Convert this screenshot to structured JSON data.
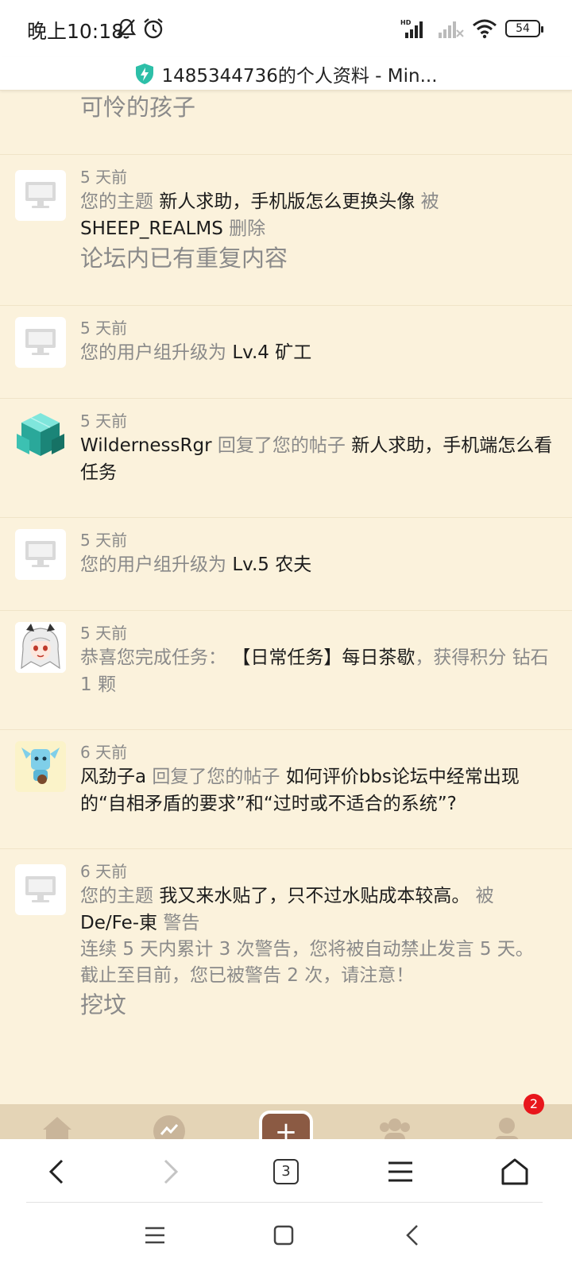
{
  "status_bar": {
    "time": "晚上10:18",
    "battery": "54",
    "icons": [
      "mute-bell-icon",
      "alarm-icon",
      "hd-signal-icon",
      "signal-no-service-icon",
      "wifi-icon",
      "battery-icon"
    ]
  },
  "url_bar": {
    "title": "1485344736的个人资料 - Min...",
    "icon": "shield-lightning-icon",
    "shield_color": "#2dbfa8"
  },
  "top_fragment": "可怜的孩子",
  "notifications": [
    {
      "avatar": "default-computer-icon",
      "time": "5 天前",
      "p1": "您的主题",
      "subject": "新人求助，手机版怎么更换头像",
      "p2": "被",
      "actor": "SHEEP_REALMS",
      "action": "删除",
      "reason": "论坛内已有重复内容"
    },
    {
      "avatar": "default-computer-icon",
      "time": "5 天前",
      "p1": "您的用户组升级为",
      "level": "Lv.4 矿工"
    },
    {
      "avatar": "diamond-block-avatar",
      "time": "5 天前",
      "user": "WildernessRgr",
      "p1": "回复了您的帖子",
      "subject": "新人求助，手机端怎么看任务"
    },
    {
      "avatar": "default-computer-icon",
      "time": "5 天前",
      "p1": "您的用户组升级为",
      "level": "Lv.5 农夫"
    },
    {
      "avatar": "anime-girl-avatar",
      "time": "5 天前",
      "p1": "恭喜您完成任务：",
      "task": "【日常任务】每日茶歇",
      "p2": "，获得积分 钻石 1 颗"
    },
    {
      "avatar": "blue-creature-avatar",
      "time": "6 天前",
      "user": "风劲子a",
      "p1": "回复了您的帖子",
      "subject": "如何评价bbs论坛中经常出现的“自相矛盾的要求”和“过时或不适合的系统”?"
    },
    {
      "avatar": "default-computer-icon",
      "time": "6 天前",
      "p1": "您的主题",
      "subject": "我又来水贴了，只不过水贴成本较高。",
      "p2": "被",
      "actor": "De/Fe-東",
      "action": "警告",
      "note1": "连续 5 天内累计 3 次警告，您将被自动禁止发言 5 天。",
      "note2": "截止至目前，您已被警告 2 次，请注意！",
      "reason": "挖坟"
    }
  ],
  "forum_nav": {
    "items": [
      "home-icon",
      "activity-icon",
      "post-plus-icon",
      "friends-icon",
      "profile-icon"
    ],
    "plus_symbol": "+",
    "badge": "2",
    "badge_color": "#e8161c",
    "accent": "#8b5a43"
  },
  "browser_toolbar": {
    "tab_count": "3",
    "items": [
      "back-icon",
      "forward-icon",
      "tabs-icon",
      "menu-icon",
      "home-icon"
    ]
  },
  "system_nav": {
    "items": [
      "recents-icon",
      "home-square-icon",
      "back-triangle-icon"
    ]
  },
  "colors": {
    "background": "#fbf2dc",
    "muted_text": "#8a8a8a",
    "text": "#1c1c1c"
  }
}
